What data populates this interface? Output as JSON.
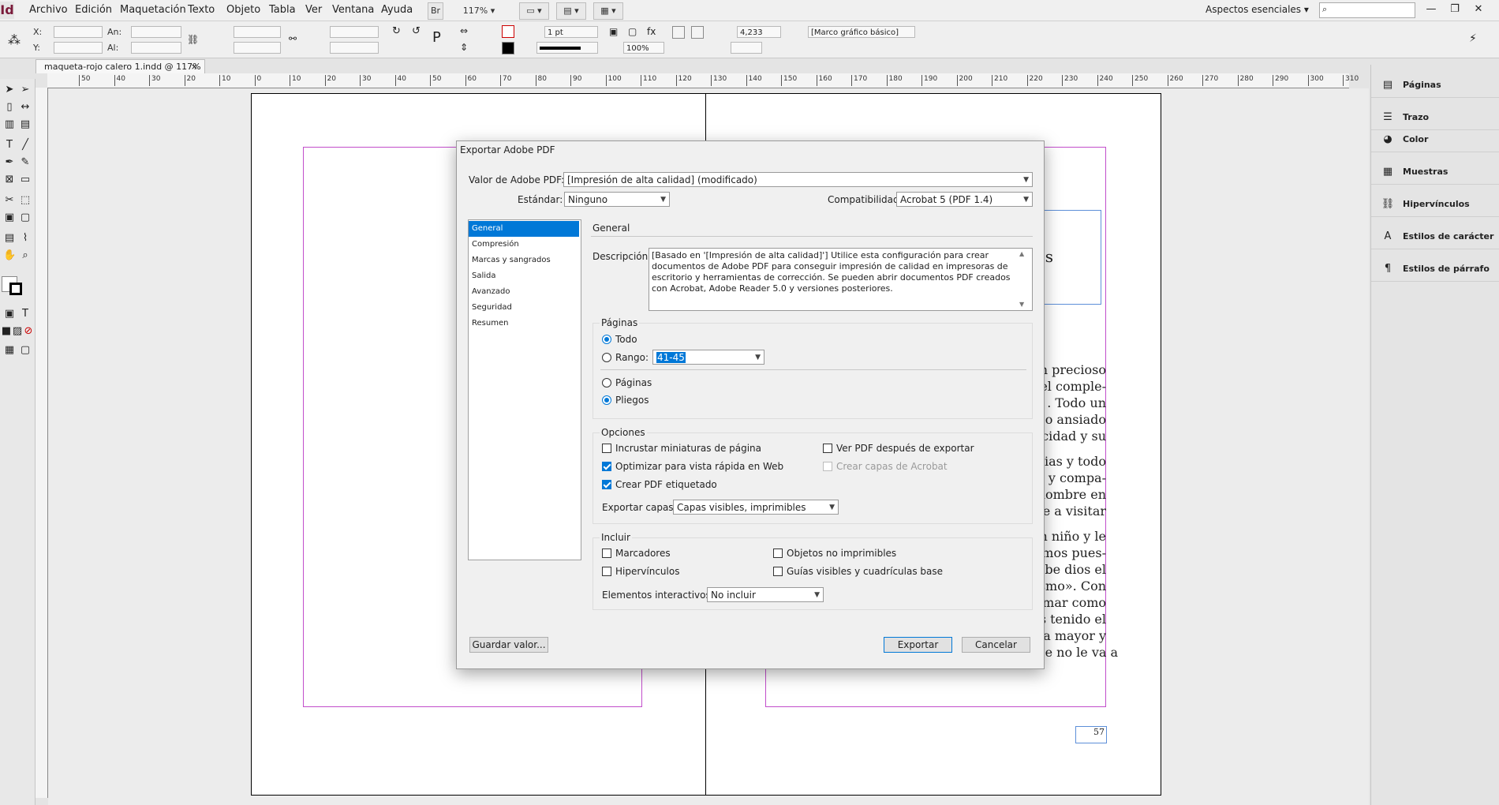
{
  "app": {
    "logo": "Id"
  },
  "menu": [
    "Archivo",
    "Edición",
    "Maquetación",
    "Texto",
    "Objeto",
    "Tabla",
    "Ver",
    "Ventana",
    "Ayuda"
  ],
  "menubar": {
    "bridge": "Br",
    "zoom": "117%",
    "workspace": "Aspectos esenciales"
  },
  "control": {
    "x_label": "X:",
    "y_label": "Y:",
    "w_label": "An:",
    "h_label": "Al:",
    "stroke_weight": "1 pt",
    "opacity": "100%",
    "dimension": "4,233 mm",
    "frame_style": "[Marco gráfico básico]"
  },
  "document": {
    "tab_title": "maqueta-rojo calero 1.indd @ 117%",
    "tab_close": "×"
  },
  "ruler": {
    "ticks": [
      "50",
      "40",
      "30",
      "20",
      "10",
      "0",
      "10",
      "20",
      "30",
      "40",
      "50",
      "60",
      "70",
      "80",
      "90",
      "100",
      "110",
      "120",
      "130",
      "140",
      "150",
      "160",
      "170",
      "180",
      "190",
      "200",
      "210",
      "220",
      "230",
      "240",
      "250",
      "260",
      "270",
      "280",
      "290",
      "300",
      "310"
    ]
  },
  "page": {
    "number": "57",
    "heading_fragment": "s",
    "body_lines": [
      "n precioso",
      "el comple-",
      ". Todo un",
      "o ansiado",
      "cidad y su",
      "",
      "cias y todo",
      ", y compa-",
      "nombre en",
      "e a visitar",
      "",
      "n niño y le",
      "emos pues-",
      "abe dios el",
      "smo». Con",
      "mar como",
      "s tenido el",
      "ea mayor y",
      "se entere de por qué se llama así seguro que no le va a"
    ]
  },
  "panels": [
    {
      "icon": "pages-icon",
      "glyph": "▤",
      "label": "Páginas"
    },
    {
      "icon": "stroke-icon",
      "glyph": "☰",
      "label": "Trazo"
    },
    {
      "icon": "color-icon",
      "glyph": "◕",
      "label": "Color"
    },
    {
      "icon": "swatches-icon",
      "glyph": "▦",
      "label": "Muestras"
    },
    {
      "icon": "hyperlinks-icon",
      "glyph": "⛓",
      "label": "Hipervínculos"
    },
    {
      "icon": "char-styles-icon",
      "glyph": "A",
      "label": "Estilos de carácter"
    },
    {
      "icon": "para-styles-icon",
      "glyph": "¶",
      "label": "Estilos de párrafo"
    }
  ],
  "dialog": {
    "title": "Exportar Adobe PDF",
    "preset_label": "Valor de Adobe PDF:",
    "preset_value": "[Impresión de alta calidad] (modificado)",
    "standard_label": "Estándar:",
    "standard_value": "Ninguno",
    "compat_label": "Compatibilidad:",
    "compat_value": "Acrobat 5 (PDF 1.4)",
    "nav": [
      "General",
      "Compresión",
      "Marcas y sangrados",
      "Salida",
      "Avanzado",
      "Seguridad",
      "Resumen"
    ],
    "section_title": "General",
    "description_label": "Descripción:",
    "description": "[Basado en '[Impresión de alta calidad]'] Utilice esta configuración para crear documentos de Adobe PDF para conseguir impresión de calidad en impresoras de escritorio y herramientas de corrección. Se pueden abrir documentos PDF creados con Acrobat, Adobe Reader 5.0 y versiones posteriores.",
    "pages_group": "Páginas",
    "radio_all": "Todo",
    "radio_range": "Rango:",
    "range_value": "41-45",
    "radio_pages": "Páginas",
    "radio_spreads": "Pliegos",
    "options_group": "Opciones",
    "opt_thumbnails": "Incrustar miniaturas de página",
    "opt_fastweb": "Optimizar para vista rápida en Web",
    "opt_tagged": "Crear PDF etiquetado",
    "opt_view_after": "Ver PDF después de exportar",
    "opt_acrobat_layers": "Crear capas de Acrobat",
    "export_layers_label": "Exportar capas:",
    "export_layers_value": "Capas visibles, imprimibles",
    "include_group": "Incluir",
    "inc_bookmarks": "Marcadores",
    "inc_hyperlinks": "Hipervínculos",
    "inc_nonprinting": "Objetos no imprimibles",
    "inc_guides": "Guías visibles y cuadrículas base",
    "interactive_label": "Elementos interactivos:",
    "interactive_value": "No incluir",
    "save_preset": "Guardar valor...",
    "export": "Exportar",
    "cancel": "Cancelar"
  }
}
